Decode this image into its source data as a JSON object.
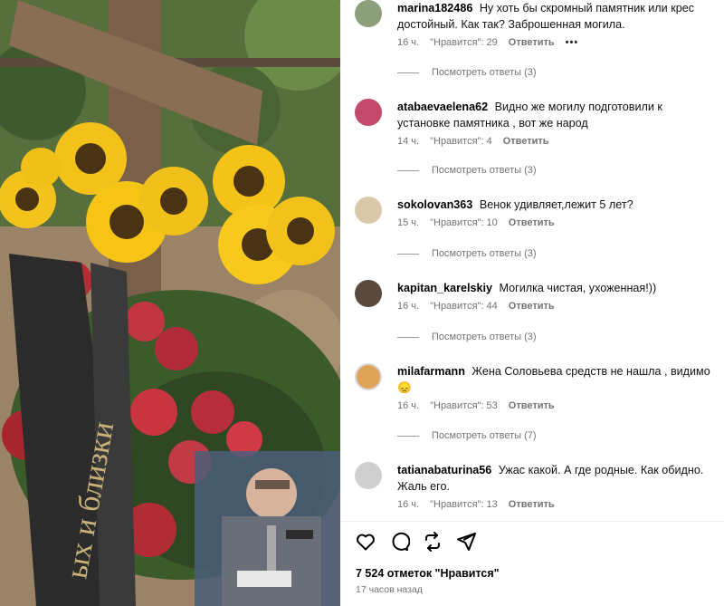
{
  "post": {
    "photo_ribbon_text": "ых и близки",
    "likes_text": "7 524 отметок \"Нравится\"",
    "time_ago": "17 часов назад"
  },
  "comments": [
    {
      "username": "marina182486",
      "text": "Ну хоть бы скромный памятник или крес достойный. Как так? Заброшенная могила.",
      "time": "16 ч.",
      "likes": "\"Нравится\": 29",
      "reply": "Ответить",
      "more": "•••",
      "replies": "Посмотреть ответы (3)",
      "avatar_color": "#8b9f7a"
    },
    {
      "username": "atabaevaelena62",
      "text": "Видно же могилу подготовили к установке памятника , вот же народ",
      "time": "14 ч.",
      "likes": "\"Нравится\": 4",
      "reply": "Ответить",
      "replies": "Посмотреть ответы (3)",
      "avatar_color": "#c24a6a"
    },
    {
      "username": "sokolovan363",
      "text": "Венок удивляет,лежит 5 лет?",
      "time": "15 ч.",
      "likes": "\"Нравится\": 10",
      "reply": "Ответить",
      "replies": "Посмотреть ответы (3)",
      "avatar_color": "#d9c9a8"
    },
    {
      "username": "kapitan_karelskiy",
      "text": "Могилка чистая, ухоженная!))",
      "time": "16 ч.",
      "likes": "\"Нравится\": 44",
      "reply": "Ответить",
      "replies": "Посмотреть ответы (3)",
      "avatar_color": "#5a4a3e"
    },
    {
      "username": "milafarmann",
      "text": "Жена Соловьева средств не нашла , видимо 😞",
      "time": "16 ч.",
      "likes": "\"Нравится\": 53",
      "reply": "Ответить",
      "replies": "Посмотреть ответы (7)",
      "avatar_color": "#e0a35a"
    },
    {
      "username": "tatianabaturina56",
      "text": "Ужас какой. А где родные. Как обидно. Жаль его.",
      "time": "16 ч.",
      "likes": "\"Нравится\": 13",
      "reply": "Ответить",
      "avatar_color": "#cfcfcf"
    }
  ],
  "icons": {
    "like": "heart-icon",
    "comment": "comment-icon",
    "share": "repost-icon",
    "send": "send-icon"
  }
}
